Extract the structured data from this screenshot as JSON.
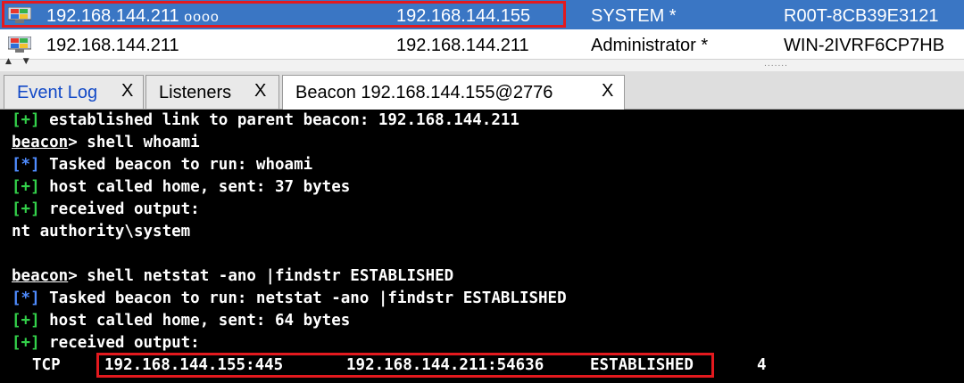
{
  "sessions": [
    {
      "icon": "windows-computer-icon",
      "external": "192.168.144.211",
      "external_suffix": "oooo",
      "internal": "192.168.144.155",
      "user": "SYSTEM *",
      "computer": "R00T-8CB39E3121",
      "selected": true
    },
    {
      "icon": "windows-computer-icon",
      "external": "192.168.144.211",
      "external_suffix": "",
      "internal": "192.168.144.211",
      "user": "Administrator *",
      "computer": "WIN-2IVRF6CP7HB",
      "selected": false
    }
  ],
  "divider": {
    "arrows": "▲ ▼",
    "grip": "......."
  },
  "tabs": [
    {
      "label": "Event Log",
      "close": "X",
      "active": false
    },
    {
      "label": "Listeners",
      "close": "X",
      "active": false
    },
    {
      "label": "Beacon 192.168.144.155@2776",
      "close": "X",
      "active": true
    }
  ],
  "console": {
    "lines": [
      {
        "tag": "[+]",
        "text": " established link to parent beacon: 192.168.144.211"
      },
      {
        "prompt": "beacon",
        "text": "> shell whoami"
      },
      {
        "tag": "[*]",
        "text": " Tasked beacon to run: whoami"
      },
      {
        "tag": "[+]",
        "text": " host called home, sent: 37 bytes"
      },
      {
        "tag": "[+]",
        "text": " received output:"
      },
      {
        "text": "nt authority\\system"
      },
      {
        "text": ""
      },
      {
        "prompt": "beacon",
        "text": "> shell netstat -ano |findstr ESTABLISHED"
      },
      {
        "tag": "[*]",
        "text": " Tasked beacon to run: netstat -ano |findstr ESTABLISHED"
      },
      {
        "tag": "[+]",
        "text": " host called home, sent: 64 bytes"
      },
      {
        "tag": "[+]",
        "text": " received output:"
      }
    ],
    "netstat": {
      "proto": "TCP",
      "local": "192.168.144.155:445",
      "remote": "192.168.144.211:54636",
      "state": "ESTABLISHED",
      "pid": "4"
    }
  },
  "colors": {
    "selection": "#3a76c4",
    "highlight_box": "#e3191e",
    "plus_tag": "#33d14a",
    "star_tag": "#4f8cff",
    "console_bg": "#000000"
  }
}
